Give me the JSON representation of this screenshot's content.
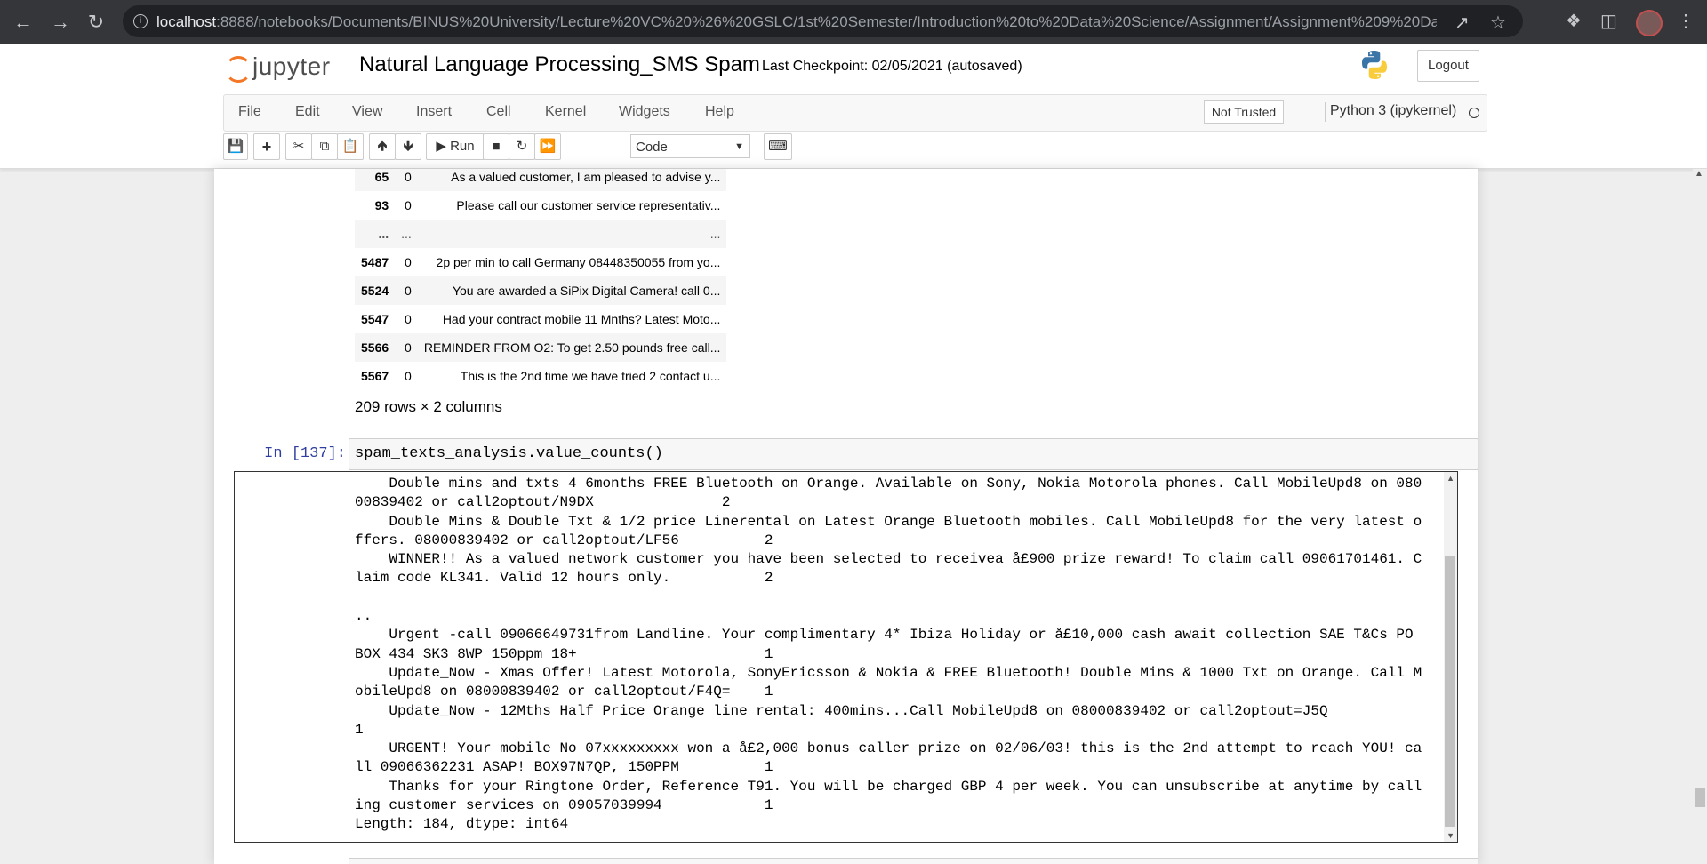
{
  "browser": {
    "url_host": "localhost",
    "url_rest": ":8888/notebooks/Documents/BINUS%20University/Lecture%20VC%20%26%20GSLC/1st%20Semester/Introduction%20to%20Data%20Science/Assignment/Assignment%209%20Dat..."
  },
  "header": {
    "logo_text": "jupyter",
    "notebook_title": "Natural Language Processing_SMS Spam",
    "checkpoint": "Last Checkpoint: 02/05/2021   (autosaved)",
    "logout": "Logout"
  },
  "menu": {
    "items": [
      "File",
      "Edit",
      "View",
      "Insert",
      "Cell",
      "Kernel",
      "Widgets",
      "Help"
    ],
    "trust_status": "Not Trusted",
    "kernel_name": "Python 3 (ipykernel)"
  },
  "toolbar": {
    "run_label": "Run",
    "cell_type": "Code"
  },
  "dataframe": {
    "rows": [
      {
        "index": "65",
        "col1": "0",
        "text": "As a valued customer, I am pleased to advise y..."
      },
      {
        "index": "93",
        "col1": "0",
        "text": "Please call our customer service representativ..."
      },
      {
        "index": "...",
        "col1": "...",
        "text": "..."
      },
      {
        "index": "5487",
        "col1": "0",
        "text": "2p per min to call Germany 08448350055 from yo..."
      },
      {
        "index": "5524",
        "col1": "0",
        "text": "You are awarded a SiPix Digital Camera! call 0..."
      },
      {
        "index": "5547",
        "col1": "0",
        "text": "Had your contract mobile 11 Mnths? Latest Moto..."
      },
      {
        "index": "5566",
        "col1": "0",
        "text": "REMINDER FROM O2: To get 2.50 pounds free call..."
      },
      {
        "index": "5567",
        "col1": "0",
        "text": "This is the 2nd time we have tried 2 contact u..."
      }
    ],
    "shape_info": "209 rows × 2 columns"
  },
  "cell": {
    "prompt": "In [137]:",
    "code": "spam_texts_analysis.value_counts()",
    "output": "    Double mins and txts 4 6months FREE Bluetooth on Orange. Available on Sony, Nokia Motorola phones. Call MobileUpd8 on 080\n00839402 or call2optout/N9DX               2\n    Double Mins & Double Txt & 1/2 price Linerental on Latest Orange Bluetooth mobiles. Call MobileUpd8 for the very latest o\nffers. 08000839402 or call2optout/LF56          2\n    WINNER!! As a valued network customer you have been selected to receivea å£900 prize reward! To claim call 09061701461. C\nlaim code KL341. Valid 12 hours only.           2\n\n..\n    Urgent -call 09066649731from Landline. Your complimentary 4* Ibiza Holiday or å£10,000 cash await collection SAE T&Cs PO\nBOX 434 SK3 8WP 150ppm 18+                      1\n    Update_Now - Xmas Offer! Latest Motorola, SonyEricsson & Nokia & FREE Bluetooth! Double Mins & 1000 Txt on Orange. Call M\nobileUpd8 on 08000839402 or call2optout/F4Q=    1\n    Update_Now - 12Mths Half Price Orange line rental: 400mins...Call MobileUpd8 on 08000839402 or call2optout=J5Q\n1\n    URGENT! Your mobile No 07xxxxxxxxx won a å£2,000 bonus caller prize on 02/06/03! this is the 2nd attempt to reach YOU! ca\nll 09066362231 ASAP! BOX97N7QP, 150PPM          1\n    Thanks for your Ringtone Order, Reference T91. You will be charged GBP 4 per week. You can unsubscribe at anytime by call\ning customer services on 09057039994            1\nLength: 184, dtype: int64"
  }
}
